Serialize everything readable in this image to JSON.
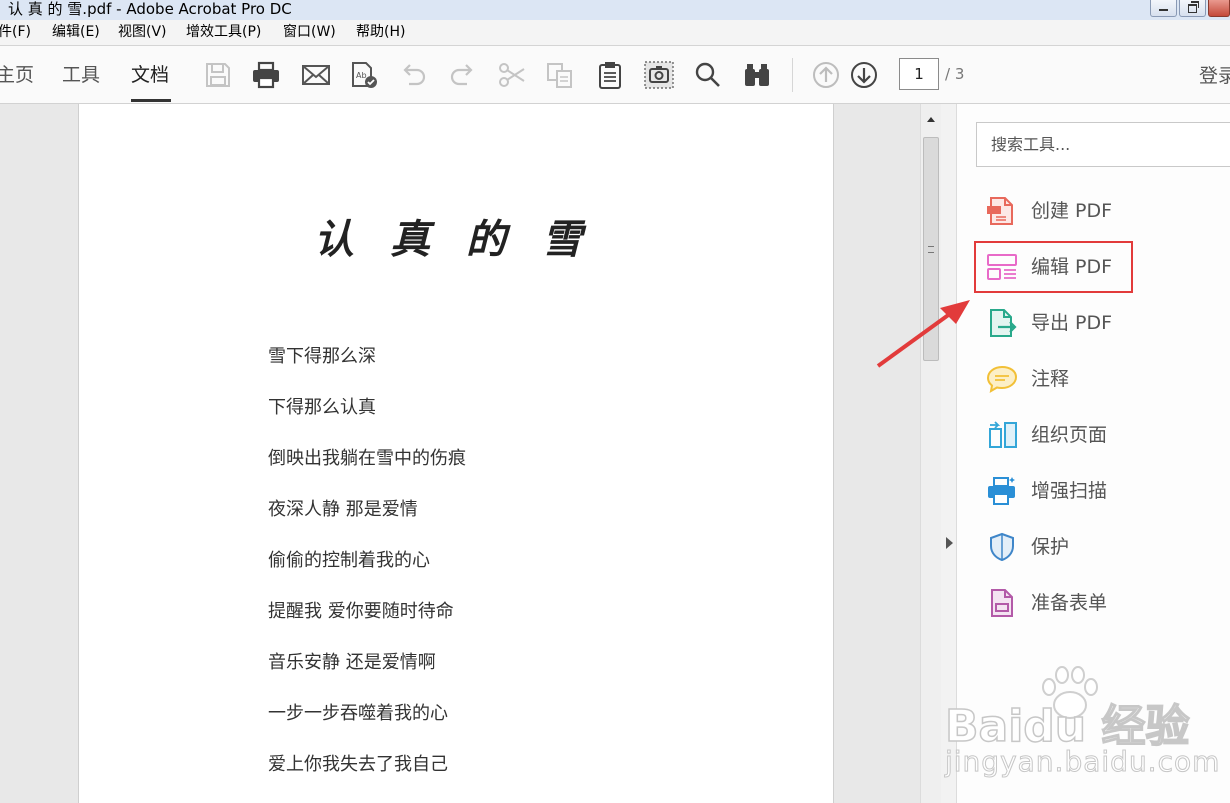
{
  "window": {
    "title": "认 真 的 雪.pdf - Adobe Acrobat Pro DC"
  },
  "menu": [
    "件(F)",
    "编辑(E)",
    "视图(V)",
    "增效工具(P)",
    "窗口(W)",
    "帮助(H)"
  ],
  "tabs": {
    "home": "主页",
    "tools": "工具",
    "document": "文档",
    "active": "文档"
  },
  "toolbar": {
    "icons": [
      "save-icon",
      "print-icon",
      "email-icon",
      "spellcheck-icon",
      "undo-icon",
      "redo-icon",
      "cut-icon",
      "copy-icon",
      "clipboard-icon",
      "snapshot-icon",
      "search-icon",
      "binoculars-icon",
      "page-up-icon",
      "page-down-icon"
    ],
    "page_current": "1",
    "page_total": "/ 3",
    "login": "登录"
  },
  "document": {
    "title": "认真的雪",
    "lines": [
      "雪下得那么深",
      "下得那么认真",
      "倒映出我躺在雪中的伤痕",
      "夜深人静  那是爱情",
      "偷偷的控制着我的心",
      "提醒我  爱你要随时待命",
      "音乐安静  还是爱情啊",
      "一步一步吞噬着我的心",
      "爱上你我失去了我自己"
    ]
  },
  "right_pane": {
    "search_placeholder": "搜索工具...",
    "tools": [
      {
        "label": "创建 PDF",
        "icon": "create-pdf-icon",
        "color": "#e8695c"
      },
      {
        "label": "编辑 PDF",
        "icon": "edit-pdf-icon",
        "color": "#e86ac8"
      },
      {
        "label": "导出 PDF",
        "icon": "export-pdf-icon",
        "color": "#29a98b"
      },
      {
        "label": "注释",
        "icon": "comment-icon",
        "color": "#f2c037"
      },
      {
        "label": "组织页面",
        "icon": "organize-pages-icon",
        "color": "#33a6d8"
      },
      {
        "label": "增强扫描",
        "icon": "enhance-scan-icon",
        "color": "#2a8fd6"
      },
      {
        "label": "保护",
        "icon": "protect-icon",
        "color": "#3f86c9"
      },
      {
        "label": "准备表单",
        "icon": "prepare-form-icon",
        "color": "#b35aa8"
      }
    ],
    "highlighted_tool": "编辑 PDF"
  },
  "annotation": {
    "color": "#e23b3b"
  },
  "watermark": {
    "brand": "Baidu 经验",
    "url": "jingyan.baidu.com"
  }
}
